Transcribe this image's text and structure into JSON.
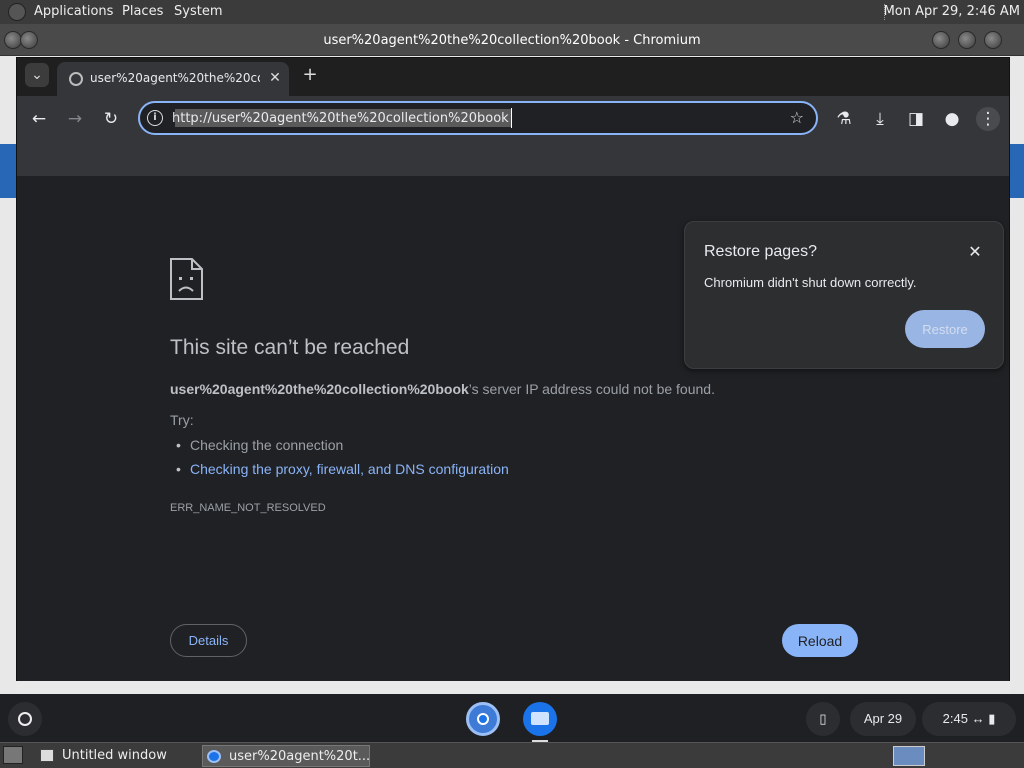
{
  "top_panel": {
    "menus": [
      "Applications",
      "Places",
      "System"
    ],
    "clock": "Mon Apr 29,  2:46 AM"
  },
  "window": {
    "title": "user%20agent%20the%20collection%20book - Chromium"
  },
  "browser": {
    "tab": {
      "title": "user%20agent%20the%20collection%20book",
      "close_icon": "close-icon"
    },
    "new_tab_label": "+",
    "address_bar": {
      "url": "http://user%20agent%20the%20collection%20book"
    },
    "toolbar_icons": [
      "back-icon",
      "forward-icon",
      "reload-icon",
      "bookmark-star-icon",
      "labs-flask-icon",
      "download-icon",
      "side-panel-icon",
      "profile-icon",
      "menu-kebab-icon"
    ]
  },
  "error_page": {
    "title": "This site can’t be reached",
    "host": "user%20agent%20the%20collection%20book",
    "desc_suffix": "’s server IP address could not be found.",
    "try_label": "Try:",
    "suggestions": [
      {
        "text": "Checking the connection",
        "is_link": false
      },
      {
        "text": "Checking the proxy, firewall, and DNS configuration",
        "is_link": true
      }
    ],
    "error_code": "ERR_NAME_NOT_RESOLVED",
    "details_label": "Details",
    "reload_label": "Reload"
  },
  "restore_popup": {
    "title": "Restore pages?",
    "message": "Chromium didn't shut down correctly.",
    "button": "Restore"
  },
  "shelf": {
    "date": "Apr 29",
    "time": "2:45"
  },
  "taskbar": {
    "items": [
      "Untitled window",
      "user%20agent%20t..."
    ]
  },
  "colors": {
    "accent": "#8ab4f8",
    "page_bg": "#202124",
    "toolbar_bg": "#35363a"
  }
}
